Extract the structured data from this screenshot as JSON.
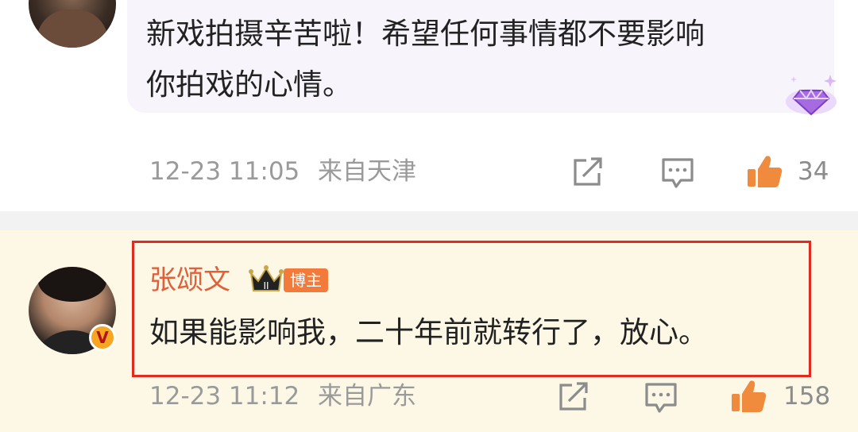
{
  "comment_top": {
    "text_line1": "新戏拍摄辛苦啦！希望任何事情都不要影响",
    "text_line2": "你拍戏的心情。",
    "timestamp": "12-23 11:05",
    "location": "来自天津",
    "like_count": "34"
  },
  "comment_reply": {
    "username": "张颂文",
    "crown_level": "II",
    "role_badge": "博主",
    "verified_badge": "V",
    "text": "如果能影响我，二十年前就转行了，放心。",
    "timestamp": "12-23 11:12",
    "location": "来自广东",
    "like_count": "158"
  },
  "icons": [
    "share-icon",
    "comment-icon",
    "like-icon",
    "diamond-badge-icon",
    "crown-icon"
  ],
  "colors": {
    "username": "#e0603a",
    "highlight_box": "#e02b20",
    "like_icon": "#f08a3c",
    "role_badge_bg": "#f27a3a",
    "reply_bg": "#fdf8e6"
  }
}
